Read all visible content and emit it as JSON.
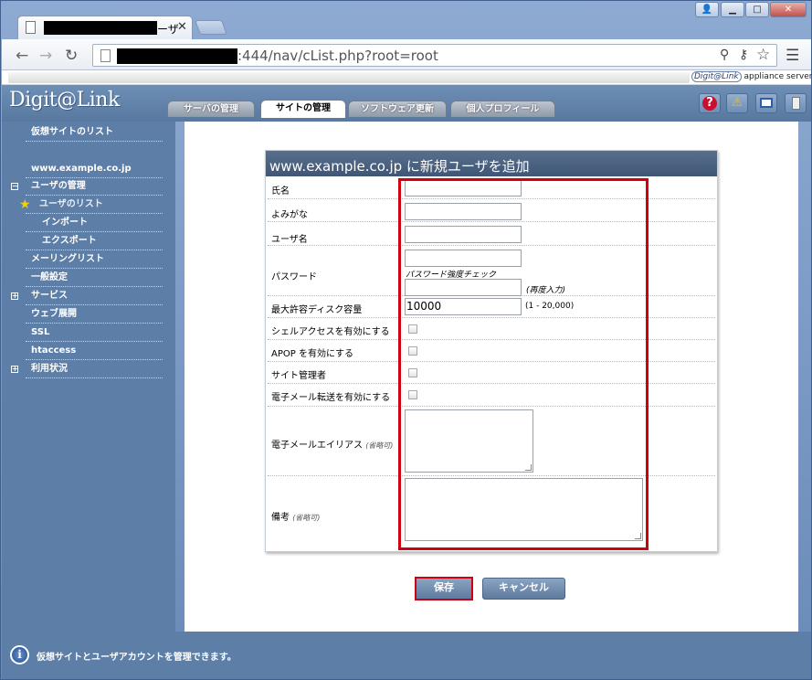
{
  "browser": {
    "tab_title": "ーザ",
    "url": ":444/nav/cList.php?root=root",
    "brand": "Digit@Link",
    "brand_suffix": "appliance server"
  },
  "app": {
    "logo": "Digit@Link",
    "tabs": [
      {
        "label": "サーバの管理",
        "active": false
      },
      {
        "label": "サイトの管理",
        "active": true
      },
      {
        "label": "ソフトウェア更新",
        "active": false
      },
      {
        "label": "個人プロフィール",
        "active": false
      }
    ],
    "header_icons": [
      "help-icon",
      "warning-icon",
      "monitor-icon",
      "logout-icon"
    ]
  },
  "sidebar": {
    "items": [
      {
        "label": "仮想サイトのリスト"
      },
      {
        "label": "www.example.co.jp"
      },
      {
        "label": "ユーザの管理",
        "expander": "−"
      },
      {
        "label": "ユーザのリスト",
        "selected": true
      },
      {
        "label": "インポート"
      },
      {
        "label": "エクスポート"
      },
      {
        "label": "メーリングリスト"
      },
      {
        "label": "一般設定"
      },
      {
        "label": "サービス",
        "expander": "+"
      },
      {
        "label": "ウェブ展開"
      },
      {
        "label": "SSL"
      },
      {
        "label": "htaccess"
      },
      {
        "label": "利用状況",
        "expander": "+"
      }
    ]
  },
  "form": {
    "title": "www.example.co.jp に新規ユーザを追加",
    "fields": {
      "name": {
        "label": "氏名",
        "value": ""
      },
      "yomigana": {
        "label": "よみがな",
        "value": ""
      },
      "username": {
        "label": "ユーザ名",
        "value": ""
      },
      "password": {
        "label": "パスワード",
        "strength_label": "パスワード強度チェック",
        "confirm_note": "(再度入力)"
      },
      "quota": {
        "label": "最大許容ディスク容量",
        "value": "10000",
        "range_note": "(1 - 20,000)"
      },
      "shell": {
        "label": "シェルアクセスを有効にする",
        "checked": false
      },
      "apop": {
        "label": "APOP を有効にする",
        "checked": false
      },
      "site_admin": {
        "label": "サイト管理者",
        "checked": false
      },
      "forward": {
        "label": "電子メール転送を有効にする",
        "checked": false
      },
      "alias": {
        "label": "電子メールエイリアス",
        "optional": "(省略可)"
      },
      "remarks": {
        "label": "備考",
        "optional": "(省略可)"
      }
    },
    "save_label": "保存",
    "cancel_label": "キャンセル"
  },
  "status": {
    "text": "仮想サイトとユーザアカウントを管理できます。"
  },
  "colors": {
    "highlight": "#d00010",
    "sidebar": "#5d7ea6",
    "form_header": "#4a6282"
  }
}
